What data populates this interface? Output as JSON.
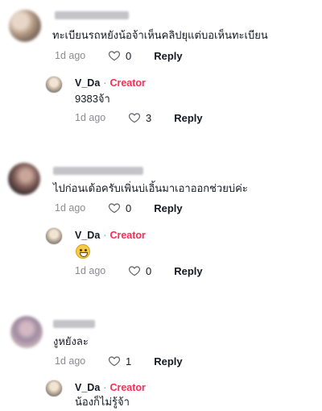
{
  "comments": [
    {
      "text": "ทะเบียนรถหยังน้อจ้าเห็นคลิปยุแต่บอเห็นทะเบียน",
      "date": "1d ago",
      "likes": "0",
      "reply_label": "Reply",
      "reply": {
        "author": "V_Da",
        "separator": "·",
        "badge": "Creator",
        "text": "9383จ้า",
        "date": "1d ago",
        "likes": "3",
        "reply_label": "Reply"
      }
    },
    {
      "text": "ไปก่อนเด้อครับเพิ่นบ่เอิ้นมาเอาออกช่วยบ่ค่ะ",
      "date": "1d ago",
      "likes": "0",
      "reply_label": "Reply",
      "reply": {
        "author": "V_Da",
        "separator": "·",
        "badge": "Creator",
        "emoji": "grinning-emoji",
        "date": "1d ago",
        "likes": "0",
        "reply_label": "Reply"
      }
    },
    {
      "text": "งูหยังละ",
      "date": "1d ago",
      "likes": "1",
      "reply_label": "Reply",
      "reply": {
        "author": "V_Da",
        "separator": "·",
        "badge": "Creator",
        "text": "น้องก็ไม่รู้จ้า"
      }
    }
  ],
  "colors": {
    "creator_badge": "#fe2c55",
    "meta_text": "#8a8b91",
    "text": "#161823"
  },
  "icons": {
    "like": "heart-outline-icon"
  }
}
